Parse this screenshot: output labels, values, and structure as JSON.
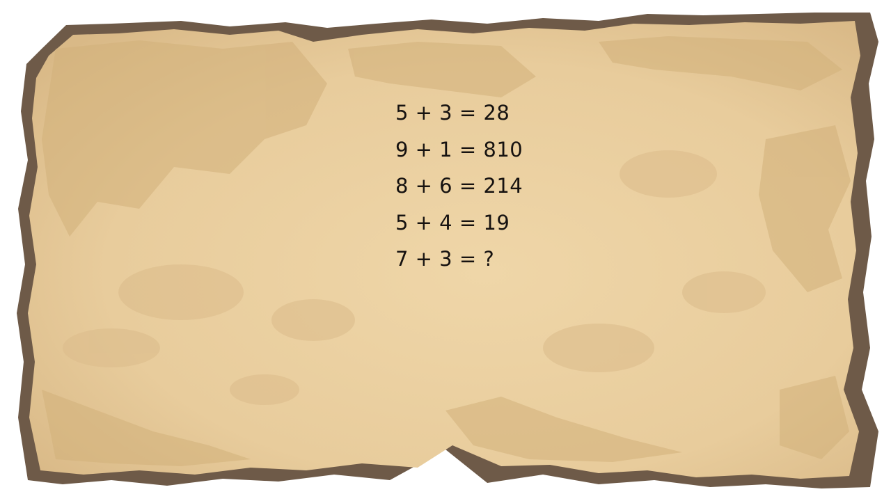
{
  "puzzle": {
    "lines": [
      "5 + 3 = 28",
      "9 + 1 = 810",
      "8 + 6 = 214",
      "5 + 4 = 19",
      "7 + 3 = ?"
    ]
  },
  "colors": {
    "background": "#ffffff",
    "parchment_base": "#e8cc9c",
    "parchment_light": "#efd6a8",
    "parchment_stain": "#d2b07a",
    "burnt_edge": "#6e5a48",
    "text": "#161210"
  }
}
